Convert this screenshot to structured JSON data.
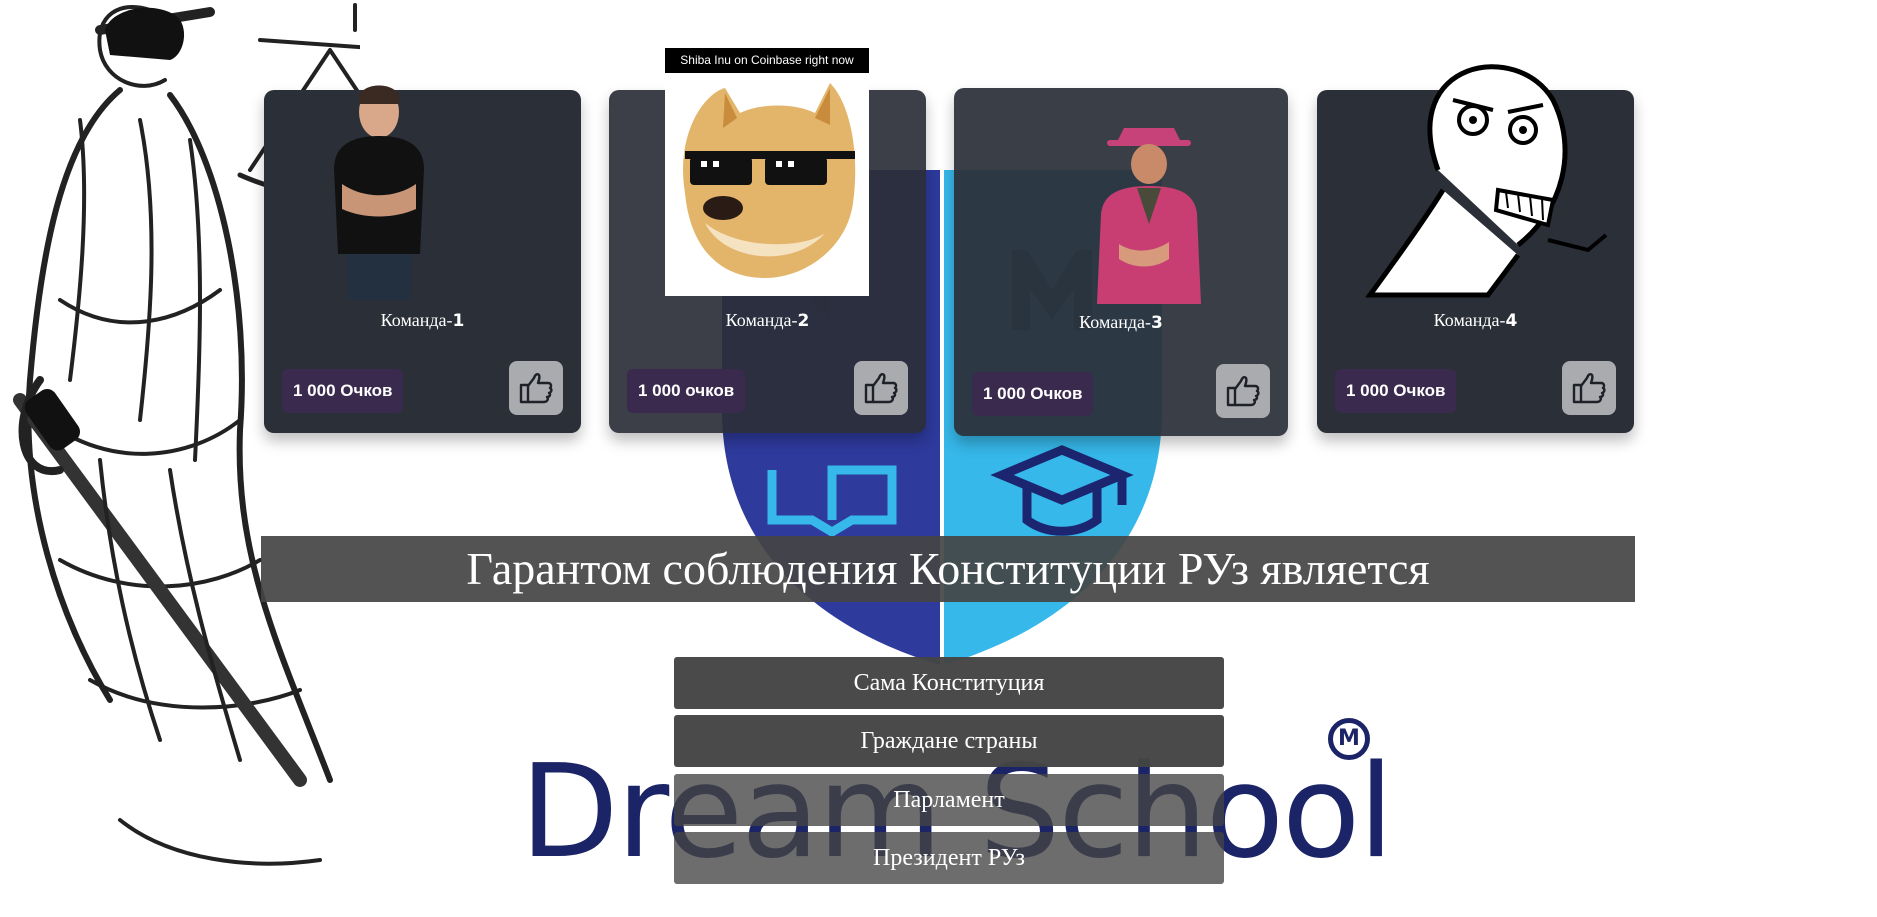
{
  "teams": [
    {
      "name_prefix": "Команда-",
      "number": "1",
      "points": "1 000 Очков",
      "photo": "man-in-black-tshirt"
    },
    {
      "name_prefix": "Команда-",
      "number": "2",
      "points": "1 000 очков",
      "photo": "doge-with-sunglasses"
    },
    {
      "name_prefix": "Команда-",
      "number": "3",
      "points": "1 000 Очков",
      "photo": "man-in-pink-suit"
    },
    {
      "name_prefix": "Команда-",
      "number": "4",
      "points": "1 000 Очков",
      "photo": "y-u-no-rage-face"
    }
  ],
  "doge_caption": "Shiba Inu on Coinbase right now",
  "heading": "Гарантом соблюдения Конституции РУз является",
  "menu": [
    "Сама Конституция",
    "Граждане страны",
    "Парламент",
    "Президент РУз"
  ],
  "brand": {
    "name": "Dream School",
    "mark": "M"
  },
  "icons": {
    "like": "thumbs-up-icon"
  },
  "colors": {
    "card_bg": "#2b2f38",
    "points_bg": "#3a2a4e",
    "like_bg": "#a9abaf",
    "bar_bg": "#444444",
    "shield_left": "#2e3a9c",
    "shield_right": "#36b8ea",
    "brand_navy": "#1b2466"
  }
}
